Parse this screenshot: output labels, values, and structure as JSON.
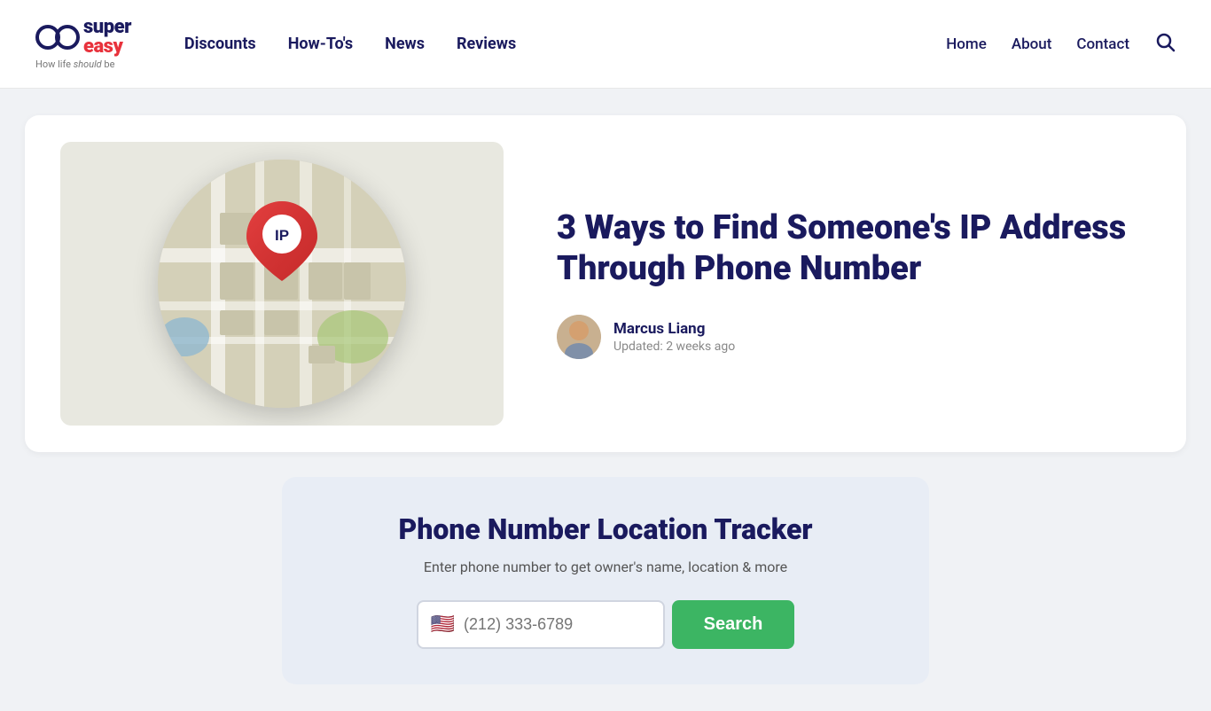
{
  "header": {
    "logo": {
      "super": "super",
      "easy": "easy",
      "tagline_pre": "How life ",
      "tagline_em": "should",
      "tagline_post": " be"
    },
    "nav": {
      "items": [
        {
          "label": "Discounts",
          "href": "#"
        },
        {
          "label": "How-To's",
          "href": "#"
        },
        {
          "label": "News",
          "href": "#"
        },
        {
          "label": "Reviews",
          "href": "#"
        }
      ]
    },
    "right_nav": {
      "items": [
        {
          "label": "Home",
          "href": "#"
        },
        {
          "label": "About",
          "href": "#"
        },
        {
          "label": "Contact",
          "href": "#"
        }
      ]
    }
  },
  "article": {
    "title": "3 Ways to Find Someone's IP Address Through Phone Number",
    "author_name": "Marcus Liang",
    "updated": "Updated: 2 weeks ago"
  },
  "tracker": {
    "title": "Phone Number Location Tracker",
    "subtitle": "Enter phone number to get owner's name, location & more",
    "input_placeholder": "(212) 333-6789",
    "search_label": "Search",
    "flag": "🇺🇸"
  }
}
